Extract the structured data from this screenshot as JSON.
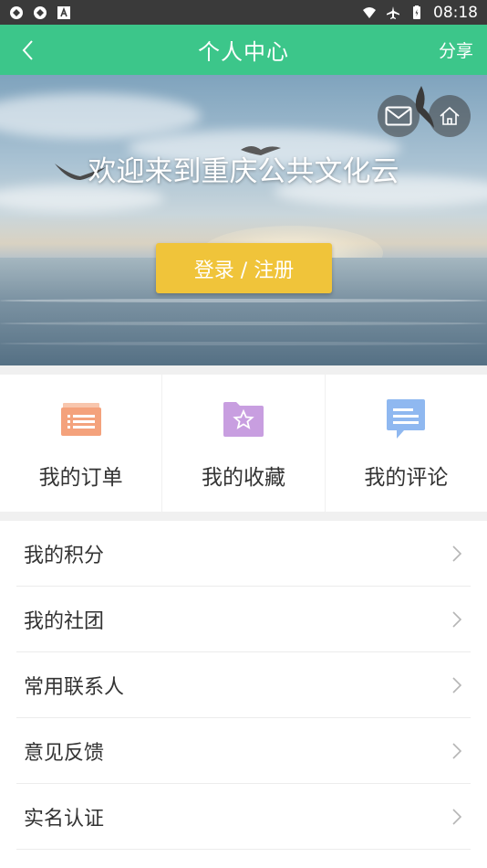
{
  "status_bar": {
    "time": "08:18"
  },
  "nav": {
    "title": "个人中心",
    "share": "分享"
  },
  "banner": {
    "welcome": "欢迎来到重庆公共文化云",
    "login_label": "登录 / 注册"
  },
  "quick": [
    {
      "label": "我的订单",
      "icon": "order-icon",
      "color": "#f4a27c"
    },
    {
      "label": "我的收藏",
      "icon": "favorite-folder-icon",
      "color": "#c89ee0"
    },
    {
      "label": "我的评论",
      "icon": "comment-icon",
      "color": "#8fb8f0"
    }
  ],
  "menu": [
    {
      "label": "我的积分"
    },
    {
      "label": "我的社团"
    },
    {
      "label": "常用联系人"
    },
    {
      "label": "意见反馈"
    },
    {
      "label": "实名认证"
    }
  ],
  "colors": {
    "primary": "#3cc68a",
    "login": "#f0c43a",
    "status_bar": "#3a3a3a"
  }
}
